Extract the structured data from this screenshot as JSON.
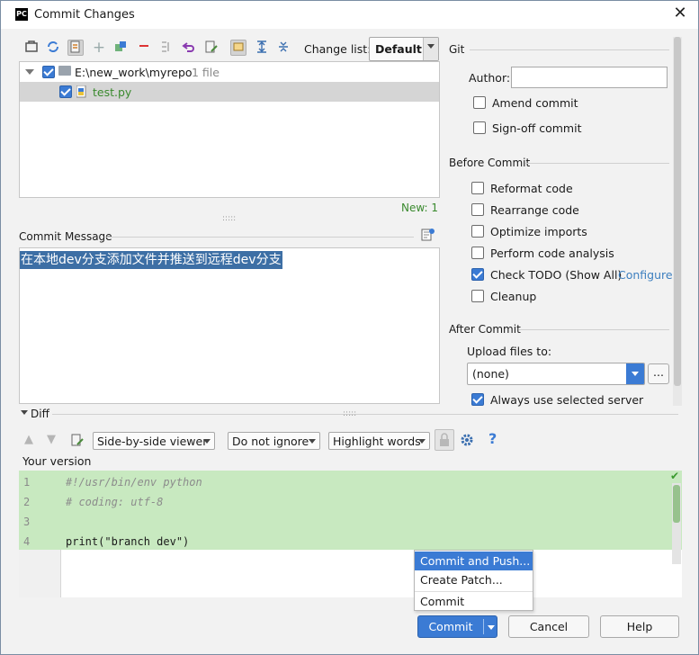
{
  "window": {
    "title": "Commit Changes",
    "app_icon": "PC",
    "close": "✕"
  },
  "toolbar": {
    "icons": [
      "refresh-icon",
      "diff-icon",
      "move-icon",
      "add-icon",
      "revert-icon",
      "delete-icon",
      "group-icon",
      "undo-icon",
      "edit-icon",
      "changelist-icon",
      "expand-icon",
      "collapse-icon"
    ],
    "changelist_label": "Change list:",
    "changelist_value": "Default"
  },
  "tree": {
    "root_path": "E:\\new_work\\myrepo",
    "root_count": "1 file",
    "file": "test.py",
    "new_count": "New: 1"
  },
  "commit_message": {
    "label": "Commit Message",
    "text": "在本地dev分支添加文件并推送到远程dev分支"
  },
  "git": {
    "section": "Git",
    "author_label": "Author:",
    "author_value": "",
    "amend": "Amend commit",
    "signoff": "Sign-off commit"
  },
  "before_commit": {
    "section": "Before Commit",
    "reformat": "Reformat code",
    "rearrange": "Rearrange code",
    "optimize": "Optimize imports",
    "analysis": "Perform code analysis",
    "todo": "Check TODO (Show All)",
    "configure": "Configure",
    "cleanup": "Cleanup"
  },
  "after_commit": {
    "section": "After Commit",
    "upload_label": "Upload files to:",
    "upload_value": "(none)",
    "upload_more": "...",
    "always_server": "Always use selected server"
  },
  "diff": {
    "section": "Diff",
    "viewer": "Side-by-side viewer",
    "ignore": "Do not ignore",
    "highlight": "Highlight words",
    "help": "?",
    "your_version": "Your version",
    "line_numbers": [
      "1",
      "2",
      "3",
      "4"
    ],
    "code": [
      "#!/usr/bin/env python",
      "# coding: utf-8",
      "",
      "print(\"branch dev\")"
    ]
  },
  "popup_menu": {
    "items": [
      "Commit and Push...",
      "Create Patch...",
      "Commit"
    ]
  },
  "buttons": {
    "commit": "Commit",
    "cancel": "Cancel",
    "help": "Help"
  },
  "colors": {
    "accent": "#3b7bd4",
    "diff_added": "#c8e9c0",
    "selection": "#3d6fa5",
    "new_count": "#3a8a2e",
    "link": "#3d7fbf"
  }
}
